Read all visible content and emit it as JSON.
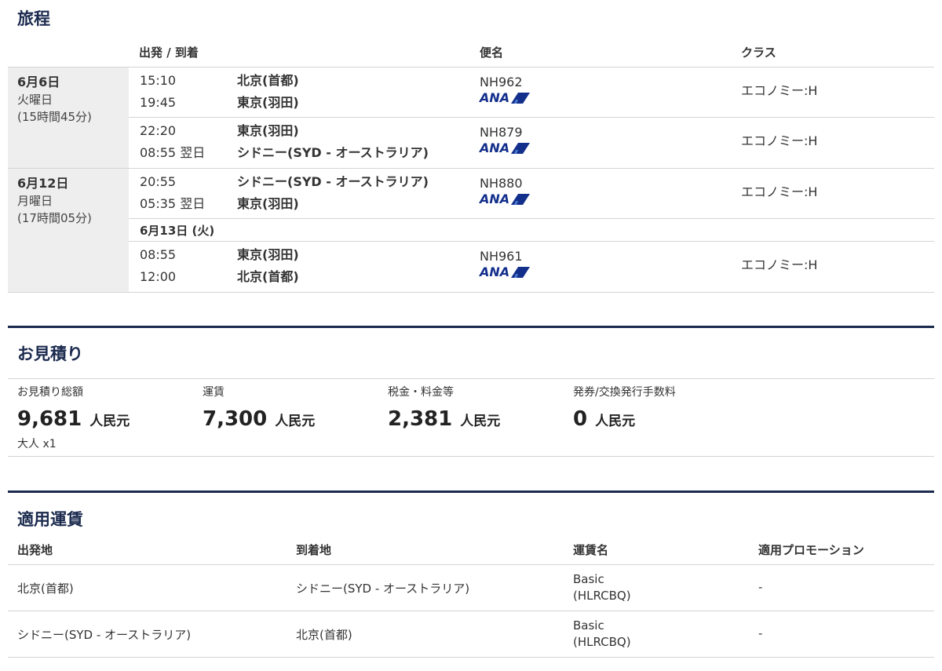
{
  "itinerary": {
    "title": "旅程",
    "headers": {
      "depart_arrive": "出発 / 到着",
      "flight": "便名",
      "class": "クラス"
    },
    "airline_logo_text": "ANA",
    "days": [
      {
        "date": "6月6日",
        "weekday": "火曜日",
        "duration": "(15時間45分)",
        "segments": [
          {
            "dep_time": "15:10",
            "dep_place": "北京(首都)",
            "arr_time": "19:45",
            "arr_place": "東京(羽田)",
            "flight": "NH962",
            "class": "エコノミー:H"
          },
          {
            "dep_time": "22:20",
            "dep_place": "東京(羽田)",
            "arr_time": "08:55 翌日",
            "arr_place": "シドニー(SYD - オーストラリア)",
            "flight": "NH879",
            "class": "エコノミー:H"
          }
        ]
      },
      {
        "date": "6月12日",
        "weekday": "月曜日",
        "duration": "(17時間05分)",
        "segments": [
          {
            "dep_time": "20:55",
            "dep_place": "シドニー(SYD - オーストラリア)",
            "arr_time": "05:35 翌日",
            "arr_place": "東京(羽田)",
            "flight": "NH880",
            "class": "エコノミー:H"
          },
          {
            "dep_time": "08:55",
            "dep_place": "東京(羽田)",
            "arr_time": "12:00",
            "arr_place": "北京(首都)",
            "flight": "NH961",
            "class": "エコノミー:H"
          }
        ],
        "date_note": "6月13日 (火)"
      }
    ]
  },
  "estimate": {
    "title": "お見積り",
    "total": {
      "label": "お見積り総額",
      "amount": "9,681",
      "currency": "人民元",
      "note": "大人 x1"
    },
    "fare": {
      "label": "運賃",
      "amount": "7,300",
      "currency": "人民元"
    },
    "taxes": {
      "label": "税金・料金等",
      "amount": "2,381",
      "currency": "人民元"
    },
    "fee": {
      "label": "発券/交換発行手数料",
      "amount": "0",
      "currency": "人民元"
    }
  },
  "fares": {
    "title": "適用運賃",
    "headers": {
      "origin": "出発地",
      "destination": "到着地",
      "fare_name": "運賃名",
      "promotion": "適用プロモーション"
    },
    "rows": [
      {
        "origin": "北京(首都)",
        "destination": "シドニー(SYD - オーストラリア)",
        "fare_name": "Basic",
        "fare_basis": "(HLRCBQ)",
        "promotion": "-"
      },
      {
        "origin": "シドニー(SYD - オーストラリア)",
        "destination": "北京(首都)",
        "fare_name": "Basic",
        "fare_basis": "(HLRCBQ)",
        "promotion": "-"
      }
    ]
  },
  "colors": {
    "heading": "#1b2a4e",
    "divider": "#1b2a4e",
    "day_bg": "#eeeeee",
    "logo": "#132f8c"
  }
}
